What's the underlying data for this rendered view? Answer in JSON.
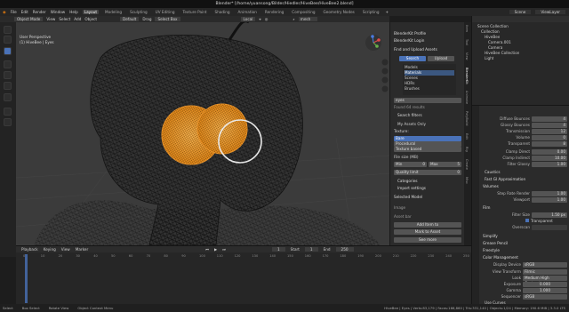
{
  "window": {
    "title": "Blender* [/home/yuansong/Bilder/Hiedler/HiveBee/HiveBee2.blend]"
  },
  "menu": [
    "File",
    "Edit",
    "Render",
    "Window",
    "Help"
  ],
  "workspaces": [
    "Layout",
    "Modeling",
    "Sculpting",
    "UV Editing",
    "Texture Paint",
    "Shading",
    "Animation",
    "Rendering",
    "Compositing",
    "Geometry Nodes",
    "Scripting"
  ],
  "scene": {
    "name": "Scene",
    "viewlayer": "ViewLayer"
  },
  "viewport": {
    "mode": "Object Mode",
    "menus": [
      "View",
      "Select",
      "Add",
      "Object"
    ],
    "orientation": "Default",
    "drag": "Drag",
    "select": "Select Box",
    "pivot": "Local",
    "search": "mesh",
    "overlay_title": "User Perspective",
    "overlay_sub": "(1) HiveBee | Eyes"
  },
  "npanel": {
    "items": [
      "BlenderKit Profile",
      "BlenderKit Login"
    ],
    "find_upload": "Find and Upload Assets",
    "tabs": [
      "Search",
      "Upload"
    ],
    "asset_types": [
      "Models",
      "Materials",
      "Scenes",
      "HDRs",
      "Brushes"
    ],
    "search_value": "eyes",
    "found": "Found 64 results",
    "search_filters": "Search filters",
    "my_assets": "My Assets Only",
    "texture_res": "Texture:",
    "tex_options": [
      "Bare",
      "Procedural",
      "Texture based"
    ],
    "file_size": "File size (MB)",
    "min": "Min",
    "min_val": "0",
    "max": "Max",
    "max_val": "5",
    "quality": "Quality limit",
    "quality_val": "0",
    "categories": "Categories",
    "import": "Import settings",
    "selected_model": "Selected Model",
    "image_label": "Image",
    "asset_bar": "Asset bar",
    "add_button": "Add Item to",
    "mark_button": "Mark to Asset",
    "see_more": "See more"
  },
  "ntabs": [
    "Item",
    "Tool",
    "View",
    "BlenderKit",
    "Animate",
    "PolyBuild",
    "Edit",
    "Rig",
    "Create",
    "Misc"
  ],
  "outliner": {
    "items": [
      "Scene Collection",
      "Collection",
      "HiveBee",
      "Camera.001",
      "Camera",
      "HiveBee Collection",
      "Light"
    ]
  },
  "props": {
    "rows": [
      {
        "label": "Diffuse Bounces",
        "value": "4"
      },
      {
        "label": "Glossy Bounces",
        "value": "4"
      },
      {
        "label": "Transmission",
        "value": "12"
      },
      {
        "label": "Volume",
        "value": "0"
      },
      {
        "label": "Transparent",
        "value": "8"
      }
    ],
    "clamp_direct": {
      "label": "Clamp Direct",
      "value": "0.00"
    },
    "clamp_indirect": {
      "label": "Clamp Indirect",
      "value": "10.00"
    },
    "filter_glossy": {
      "label": "Filter Glossy",
      "value": "1.00"
    },
    "caustics": "Caustics",
    "fast_gi": "Fast GI Approximation",
    "volumes": "Volumes",
    "step_rate_render": {
      "label": "Step Rate Render",
      "value": "1.00"
    },
    "step_rate_viewport": {
      "label": "Viewport",
      "value": "1.00"
    },
    "film": "Film",
    "filter_size": {
      "label": "Filter Size",
      "value": "1.50 px"
    },
    "transparent": "Transparent",
    "denoise": "Overscan",
    "simplify": "Simplify",
    "grease_pencil": "Grease Pencil",
    "freestyle": "Freestyle",
    "color_mgmt": "Color Management",
    "display_device": {
      "label": "Display Device",
      "value": "sRGB"
    },
    "view_transform": {
      "label": "View Transform",
      "value": "Filmic"
    },
    "look": {
      "label": "Look",
      "value": "Medium High Contrast"
    },
    "exposure": {
      "label": "Exposure",
      "value": "0.000"
    },
    "gamma": {
      "label": "Gamma",
      "value": "1.000"
    },
    "sequencer": {
      "label": "Sequencer",
      "value": "sRGB"
    },
    "use_curves": "Use Curves"
  },
  "timeline": {
    "menus": [
      "Playback",
      "Keying",
      "View",
      "Marker"
    ],
    "current_frame": "1",
    "start": "Start",
    "start_val": "1",
    "end": "End",
    "end_val": "250",
    "ticks": [
      "0",
      "10",
      "20",
      "30",
      "40",
      "50",
      "60",
      "70",
      "80",
      "90",
      "100",
      "110",
      "120",
      "130",
      "140",
      "150",
      "160",
      "170",
      "180",
      "190",
      "200",
      "210",
      "220",
      "230",
      "240",
      "250"
    ]
  },
  "status": {
    "left": "Select",
    "mid": "Box Select",
    "rot": "Rotate View",
    "ctx": "Object Context Menu",
    "right": "HiveBee | Eyes | Verts:83,179 | Faces:166,860 | Tris:331,140 | Objects:1/24 | Memory: 190.6 MiB | 3.3.0 LTS"
  },
  "colors": {
    "accent": "#4a72b8",
    "selection": "#f29a2e",
    "bg": "#3a3a3a"
  }
}
